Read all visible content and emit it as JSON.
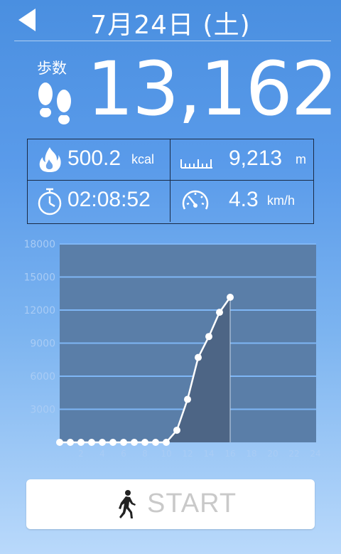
{
  "header": {
    "title": "7月24日 (土)",
    "back_icon": "back-arrow-icon"
  },
  "steps": {
    "label": "歩数",
    "value": "13,162",
    "icon": "footprints-icon"
  },
  "stats": {
    "calories": {
      "value": "500.2",
      "unit": "kcal",
      "icon": "flame-icon"
    },
    "distance": {
      "value": "9,213",
      "unit": "m",
      "icon": "ruler-icon"
    },
    "duration": {
      "value": "02:08:52",
      "icon": "stopwatch-icon"
    },
    "speed": {
      "value": "4.3",
      "unit": "km/h",
      "icon": "speedometer-icon"
    }
  },
  "chart_data": {
    "type": "area",
    "x": [
      0,
      1,
      2,
      3,
      4,
      5,
      6,
      7,
      8,
      9,
      10,
      11,
      12,
      13,
      14,
      15,
      16
    ],
    "y": [
      0,
      0,
      0,
      0,
      0,
      0,
      0,
      0,
      0,
      0,
      0,
      1100,
      3900,
      7700,
      9600,
      11800,
      13162
    ],
    "x_tick_labels": [
      "",
      "2",
      "4",
      "6",
      "8",
      "10",
      "12",
      "14",
      "16",
      "18",
      "20",
      "22",
      "24"
    ],
    "y_tick_labels": [
      "",
      "3000",
      "6000",
      "9000",
      "12000",
      "15000",
      "18000"
    ],
    "ylim": [
      0,
      18000
    ],
    "colors": {
      "plot_bg": "#5a7ea8",
      "fill": "#4d6585",
      "line": "#ffffff",
      "grid": "#7fb6f5"
    }
  },
  "start_button": {
    "label": "START",
    "icon": "walking-person-icon"
  }
}
